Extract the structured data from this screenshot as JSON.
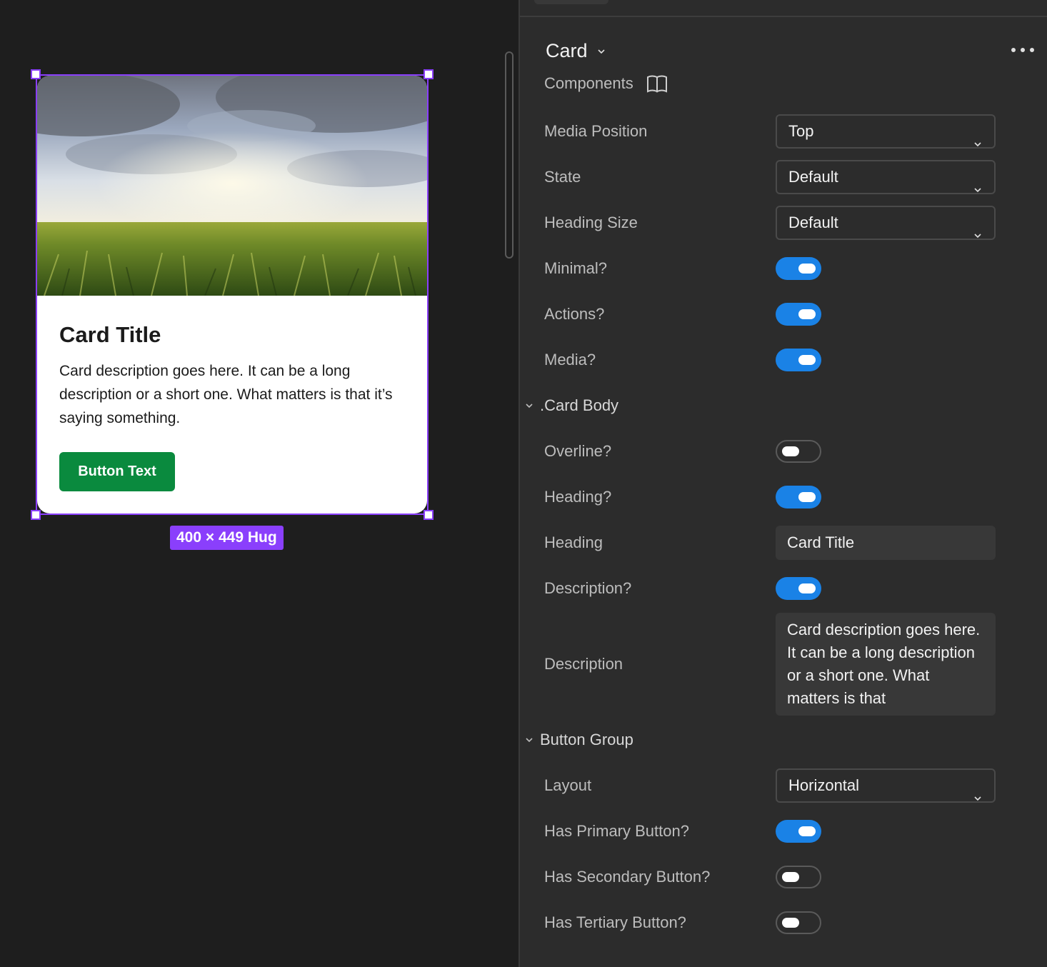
{
  "canvas": {
    "card": {
      "title": "Card Title",
      "description": "Card description goes here. It can be a long description or a short one. What matters is that it’s saying something.",
      "button_label": "Button Text"
    },
    "size_badge": "400 × 449 Hug"
  },
  "panel": {
    "component_name": "Card",
    "components_link": "Components",
    "properties": {
      "media_position": {
        "label": "Media Position",
        "value": "Top"
      },
      "state": {
        "label": "State",
        "value": "Default"
      },
      "heading_size": {
        "label": "Heading Size",
        "value": "Default"
      },
      "minimal": {
        "label": "Minimal?",
        "on": true
      },
      "actions": {
        "label": "Actions?",
        "on": true
      },
      "media": {
        "label": "Media?",
        "on": true
      }
    },
    "card_body": {
      "section_label": ".Card Body",
      "overline": {
        "label": "Overline?",
        "on": false
      },
      "heading_toggle": {
        "label": "Heading?",
        "on": true
      },
      "heading": {
        "label": "Heading",
        "value": "Card Title"
      },
      "description_toggle": {
        "label": "Description?",
        "on": true
      },
      "description": {
        "label": "Description",
        "value": "Card description goes here. It can be a long description or a short one. What matters is that"
      }
    },
    "button_group": {
      "section_label": "Button Group",
      "layout": {
        "label": "Layout",
        "value": "Horizontal"
      },
      "has_primary": {
        "label": "Has Primary Button?",
        "on": true
      },
      "has_secondary": {
        "label": "Has Secondary Button?",
        "on": false
      },
      "has_tertiary": {
        "label": "Has Tertiary Button?",
        "on": false
      }
    }
  },
  "colors": {
    "selection": "#8a3ffc",
    "toggle_on": "#1a82e6",
    "card_button": "#0a8a3e"
  }
}
